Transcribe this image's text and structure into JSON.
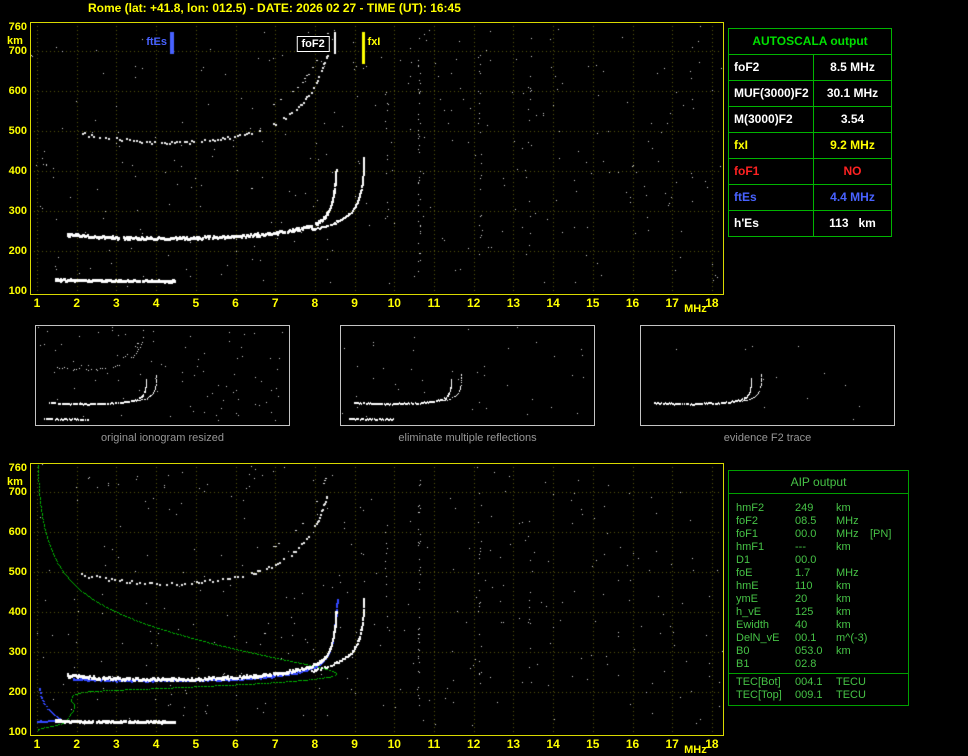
{
  "header": {
    "title": "Rome (lat: +41.8, lon: 012.5) - DATE: 2026 02 27 - TIME (UT): 16:45"
  },
  "autoscala_table": {
    "title": "AUTOSCALA output",
    "rows": [
      {
        "label": "foF2",
        "value": "8.5 MHz",
        "color": "#ffffff"
      },
      {
        "label": "MUF(3000)F2",
        "value": "30.1 MHz",
        "color": "#ffffff"
      },
      {
        "label": "M(3000)F2",
        "value": "3.54",
        "color": "#ffffff"
      },
      {
        "label": "fxI",
        "value": "9.2 MHz",
        "color": "#ffff00"
      },
      {
        "label": "foF1",
        "value": "NO",
        "color": "#ff2222"
      },
      {
        "label": "ftEs",
        "value": "4.4 MHz",
        "color": "#4862ff"
      },
      {
        "label": "h'Es",
        "value": "113   km",
        "color": "#ffffff"
      }
    ]
  },
  "aip_table": {
    "title": "AIP output",
    "rows": [
      {
        "label": "hmF2",
        "value": "249",
        "unit": "km",
        "note": ""
      },
      {
        "label": "foF2",
        "value": "08.5",
        "unit": "MHz",
        "note": ""
      },
      {
        "label": "foF1",
        "value": "00.0",
        "unit": "MHz",
        "note": "[PN]"
      },
      {
        "label": "hmF1",
        "value": "---",
        "unit": "km",
        "note": ""
      },
      {
        "label": "D1",
        "value": "00.0",
        "unit": "",
        "note": ""
      },
      {
        "label": "foE",
        "value": "1.7",
        "unit": "MHz",
        "note": ""
      },
      {
        "label": "hmE",
        "value": "110",
        "unit": "km",
        "note": ""
      },
      {
        "label": "ymE",
        "value": "20",
        "unit": "km",
        "note": ""
      },
      {
        "label": "h_vE",
        "value": "125",
        "unit": "km",
        "note": ""
      },
      {
        "label": "Ewidth",
        "value": "40",
        "unit": "km",
        "note": ""
      },
      {
        "label": "DelN_vE",
        "value": "00.1",
        "unit": "m^(-3)",
        "note": ""
      },
      {
        "label": "B0",
        "value": "053.0",
        "unit": "km",
        "note": ""
      },
      {
        "label": "B1",
        "value": "02.8",
        "unit": "",
        "note": ""
      }
    ],
    "tec_rows": [
      {
        "label": "TEC[Bot]",
        "value": "004.1",
        "unit": "TECU"
      },
      {
        "label": "TEC[Top]",
        "value": "009.1",
        "unit": "TECU"
      }
    ]
  },
  "thumbnails": [
    {
      "caption": "original ionogram resized",
      "trace_refs": [
        "Es-layer-trace",
        "F2-trace-ordinary",
        "F2-trace-extraordinary",
        "F2-second-hop",
        "F2-second-hop-x"
      ],
      "noise": 90
    },
    {
      "caption": "eliminate multiple reflections",
      "trace_refs": [
        "Es-layer-trace",
        "F2-trace-ordinary",
        "F2-trace-extraordinary"
      ],
      "noise": 40
    },
    {
      "caption": "evidence F2 trace",
      "trace_refs": [
        "F2-trace-ordinary",
        "F2-trace-extraordinary"
      ],
      "noise": 12
    }
  ],
  "chart_data": [
    {
      "id": "main-ionogram",
      "type": "scatter",
      "title": "Recorded ionogram with AUTOSCALA characteristic frequencies",
      "xlabel": "MHz",
      "ylabel": "km",
      "xlim": [
        1,
        18
      ],
      "ylim": [
        100,
        760
      ],
      "x_ticks": [
        1,
        2,
        3,
        4,
        5,
        6,
        7,
        8,
        9,
        10,
        11,
        12,
        13,
        14,
        15,
        16,
        17,
        18
      ],
      "y_ticks": [
        760,
        700,
        600,
        500,
        400,
        300,
        200,
        100
      ],
      "grid": true,
      "grid_color": "#56560c",
      "markers": [
        {
          "label": "ftEs",
          "freq_mhz": 4.4,
          "color": "#4862ff",
          "align": "right",
          "boxed": false
        },
        {
          "label": "foF2",
          "freq_mhz": 8.5,
          "color": "#ffffff",
          "align": "right",
          "boxed": true
        },
        {
          "label": "fxI",
          "freq_mhz": 9.2,
          "color": "#ffff00",
          "align": "left",
          "boxed": false
        }
      ],
      "traces": [
        {
          "name": "Es-layer-trace",
          "color": "#ffffff",
          "thickness": 3,
          "spacing": 1.1,
          "density": 0.96,
          "jitter": 0.8,
          "points": [
            [
              1.45,
              127
            ],
            [
              2.6,
              125
            ],
            [
              4.45,
              124
            ]
          ]
        },
        {
          "name": "F2-trace-ordinary",
          "color": "#ffffff",
          "thickness": 3,
          "spacing": 1.1,
          "density": 0.92,
          "jitter": 1.2,
          "points": [
            [
              1.75,
              240
            ],
            [
              2.6,
              234
            ],
            [
              3.6,
              231
            ],
            [
              4.6,
              231
            ],
            [
              5.6,
              234
            ],
            [
              6.6,
              240
            ],
            [
              7.3,
              249
            ],
            [
              7.9,
              263
            ],
            [
              8.2,
              281
            ],
            [
              8.38,
              310
            ],
            [
              8.48,
              355
            ],
            [
              8.52,
              400
            ]
          ]
        },
        {
          "name": "F2-trace-extraordinary",
          "color": "#ffffff",
          "thickness": 2,
          "spacing": 1.2,
          "density": 0.9,
          "jitter": 1,
          "points": [
            [
              7.9,
              252
            ],
            [
              8.4,
              266
            ],
            [
              8.8,
              288
            ],
            [
              9.05,
              320
            ],
            [
              9.18,
              370
            ],
            [
              9.22,
              432
            ]
          ]
        },
        {
          "name": "F2-second-hop",
          "color": "#e8e8e8",
          "thickness": 2,
          "spacing": 2.6,
          "density": 0.65,
          "jitter": 1.5,
          "points": [
            [
              2.1,
              492
            ],
            [
              3.0,
              478
            ],
            [
              4.0,
              470
            ],
            [
              5.0,
              472
            ],
            [
              5.9,
              484
            ],
            [
              6.6,
              502
            ],
            [
              7.2,
              530
            ],
            [
              7.7,
              572
            ],
            [
              8.05,
              625
            ],
            [
              8.3,
              690
            ]
          ]
        },
        {
          "name": "F2-second-hop-x",
          "color": "#dcdcdc",
          "thickness": 1,
          "spacing": 3.5,
          "density": 0.4,
          "jitter": 1.5,
          "points": [
            [
              6.9,
              560
            ],
            [
              7.5,
              605
            ],
            [
              8.0,
              670
            ],
            [
              8.3,
              745
            ]
          ]
        }
      ],
      "noise": {
        "count": 300,
        "color": "#d0d0d0"
      },
      "noise_columns": [
        {
          "f": 10.62,
          "count": 42,
          "h": [
            150,
            745
          ]
        },
        {
          "f": 12.15,
          "count": 22,
          "h": [
            160,
            700
          ]
        },
        {
          "f": 9.8,
          "count": 14,
          "h": [
            280,
            620
          ]
        },
        {
          "f": 13.4,
          "count": 12,
          "h": [
            200,
            640
          ]
        }
      ]
    },
    {
      "id": "aip-ionogram",
      "type": "scatter",
      "title": "Ionogram with restored F2 trace and electron density profile",
      "xlabel": "MHz",
      "ylabel": "km",
      "xlim": [
        1,
        18
      ],
      "ylim": [
        100,
        760
      ],
      "x_ticks": [
        1,
        2,
        3,
        4,
        5,
        6,
        7,
        8,
        9,
        10,
        11,
        12,
        13,
        14,
        15,
        16,
        17,
        18
      ],
      "y_ticks": [
        760,
        700,
        600,
        500,
        400,
        300,
        200,
        100
      ],
      "grid": true,
      "grid_color": "#56560c",
      "inherit_traces_from": "main-ionogram",
      "profile": {
        "name": "electron-density-profile",
        "color": "#00b400",
        "points": [
          [
            1.02,
            768
          ],
          [
            1.05,
            705
          ],
          [
            1.12,
            645
          ],
          [
            1.25,
            588
          ],
          [
            1.45,
            536
          ],
          [
            1.73,
            492
          ],
          [
            2.15,
            450
          ],
          [
            2.8,
            410
          ],
          [
            3.7,
            372
          ],
          [
            4.8,
            338
          ],
          [
            5.9,
            310
          ],
          [
            6.9,
            288
          ],
          [
            7.8,
            269
          ],
          [
            8.3,
            257
          ],
          [
            8.52,
            248
          ],
          [
            8.44,
            240
          ],
          [
            7.8,
            231
          ],
          [
            6.6,
            222
          ],
          [
            5.2,
            215
          ],
          [
            3.9,
            209
          ],
          [
            2.9,
            205
          ],
          [
            2.25,
            201
          ],
          [
            1.95,
            194
          ],
          [
            1.86,
            181
          ],
          [
            1.93,
            168
          ],
          [
            1.9,
            153
          ],
          [
            1.8,
            139
          ],
          [
            1.72,
            128
          ],
          [
            1.56,
            120
          ],
          [
            1.32,
            114
          ],
          [
            1.1,
            110
          ],
          [
            1.02,
            105
          ]
        ]
      },
      "overlays": [
        {
          "name": "F2-fit-autoscala",
          "color": "#3348ff",
          "thickness": 2,
          "spacing": 1.3,
          "density": 0.95,
          "jitter": 0.8,
          "points": [
            [
              1.9,
              231
            ],
            [
              3.0,
              228
            ],
            [
              4.5,
              228
            ],
            [
              6.0,
              231
            ],
            [
              7.0,
              239
            ],
            [
              7.8,
              255
            ],
            [
              8.2,
              278
            ],
            [
              8.4,
              315
            ],
            [
              8.5,
              372
            ],
            [
              8.55,
              430
            ]
          ]
        },
        {
          "name": "Es-fit-autoscala",
          "color": "#3348ff",
          "thickness": 2,
          "spacing": 1.3,
          "density": 0.95,
          "jitter": 0.5,
          "points": [
            [
              1.0,
              126
            ],
            [
              1.72,
              126
            ]
          ]
        },
        {
          "name": "E-fit-arc",
          "color": "#3348ff",
          "thickness": 1,
          "spacing": 1.6,
          "density": 0.9,
          "jitter": 0.5,
          "points": [
            [
              1.05,
              208
            ],
            [
              1.1,
              186
            ],
            [
              1.22,
              164
            ],
            [
              1.38,
              146
            ],
            [
              1.58,
              132
            ],
            [
              1.72,
              126
            ]
          ]
        }
      ],
      "noise": {
        "count": 300,
        "color": "#d0d0d0"
      },
      "noise_columns": [
        {
          "f": 10.62,
          "count": 38,
          "h": [
            150,
            745
          ]
        },
        {
          "f": 12.15,
          "count": 20,
          "h": [
            160,
            700
          ]
        },
        {
          "f": 9.8,
          "count": 12,
          "h": [
            280,
            620
          ]
        },
        {
          "f": 13.4,
          "count": 12,
          "h": [
            200,
            640
          ]
        }
      ]
    }
  ]
}
